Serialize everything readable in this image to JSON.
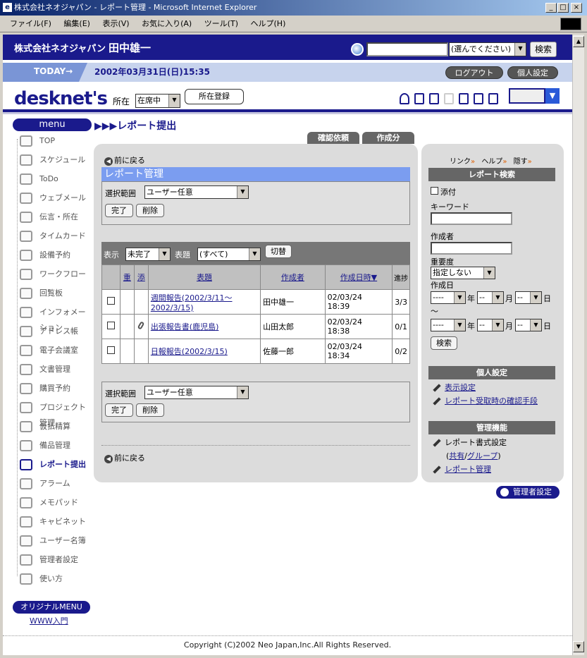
{
  "window": {
    "title": "株式会社ネオジャパン - レポート管理 - Microsoft Internet Explorer"
  },
  "menubar": [
    "ファイル(F)",
    "編集(E)",
    "表示(V)",
    "お気に入り(A)",
    "ツール(T)",
    "ヘルプ(H)"
  ],
  "header": {
    "company": "株式会社ネオジャパン",
    "user": "田中雄一",
    "search_placeholder": "",
    "search_scope": "(選んでください)",
    "search_button": "検索",
    "today_label": "TODAY→",
    "datetime": "2002年03月31日(日)15:35",
    "logout": "ログアウト",
    "personal_settings": "個人設定"
  },
  "logo_row": {
    "logo": "desknet's",
    "location_label": "所在",
    "location_value": "在席中",
    "register_button": "所在登録"
  },
  "menu": {
    "title": "menu",
    "items": [
      "TOP",
      "スケジュール",
      "ToDo",
      "ウェブメール",
      "伝言・所在",
      "タイムカード",
      "設備予約",
      "ワークフロー",
      "回覧板",
      "インフォメーション",
      "アドレス帳",
      "電子会議室",
      "文書管理",
      "購買予約",
      "プロジェクト管理",
      "仮払精算",
      "備品管理",
      "レポート提出",
      "アラーム",
      "メモパッド",
      "キャビネット",
      "ユーザー名簿",
      "管理者設定",
      "使い方"
    ],
    "active": "レポート提出",
    "original_menu": "オリジナルMENU",
    "www_link": "WWW入門"
  },
  "main": {
    "page_heading": "▶▶▶レポート提出",
    "tabs": [
      "確認依頼",
      "作成分"
    ],
    "back_link": "前に戻る",
    "report_mgmt_title": "レポート管理",
    "range_label": "選択範囲",
    "range_value": "ユーザー任意",
    "done_button": "完了",
    "delete_button": "削除",
    "display_label": "表示",
    "display_value": "未完了",
    "subject_label": "表題",
    "subject_value": "(すべて)",
    "switch_button": "切替",
    "columns": [
      "重",
      "添",
      "表題",
      "作成者",
      "作成日時▼",
      "進捗"
    ],
    "rows": [
      {
        "attach": "",
        "title": "週間報告(2002/3/11～2002/3/15)",
        "author": "田中雄一",
        "date": "02/03/24",
        "time": "18:39",
        "progress": "3/3"
      },
      {
        "attach": "clip",
        "title": "出張報告書(鹿児島)",
        "author": "山田太郎",
        "date": "02/03/24",
        "time": "18:38",
        "progress": "0/1"
      },
      {
        "attach": "",
        "title": "日報報告(2002/3/15)",
        "author": "佐藤一郎",
        "date": "02/03/24",
        "time": "18:34",
        "progress": "0/2"
      }
    ]
  },
  "right": {
    "links": [
      "リンク",
      "ヘルプ",
      "隠す"
    ],
    "search_title": "レポート検索",
    "attach_label": "添付",
    "keyword_label": "キーワード",
    "author_label": "作成者",
    "importance_label": "重要度",
    "importance_value": "指定しない",
    "created_label": "作成日",
    "year_placeholder": "----",
    "md_placeholder": "--",
    "year_unit": "年",
    "month_unit": "月",
    "day_unit": "日",
    "tilde": "～",
    "search_button": "検索",
    "personal_title": "個人設定",
    "personal_links": [
      "表示設定",
      "レポート受取時の確認手段"
    ],
    "admin_title": "管理機能",
    "admin_items": [
      "レポート書式設定"
    ],
    "admin_shared": "共有",
    "admin_slash": "/",
    "admin_group": "グループ",
    "admin_paren_open": "(",
    "admin_paren_close": ")",
    "admin_report_mgmt": "レポート管理",
    "admin_settings_button": "管理者設定"
  },
  "footer": {
    "copyright": "Copyright (C)2002 Neo Japan,Inc.All Rights Reserved."
  }
}
